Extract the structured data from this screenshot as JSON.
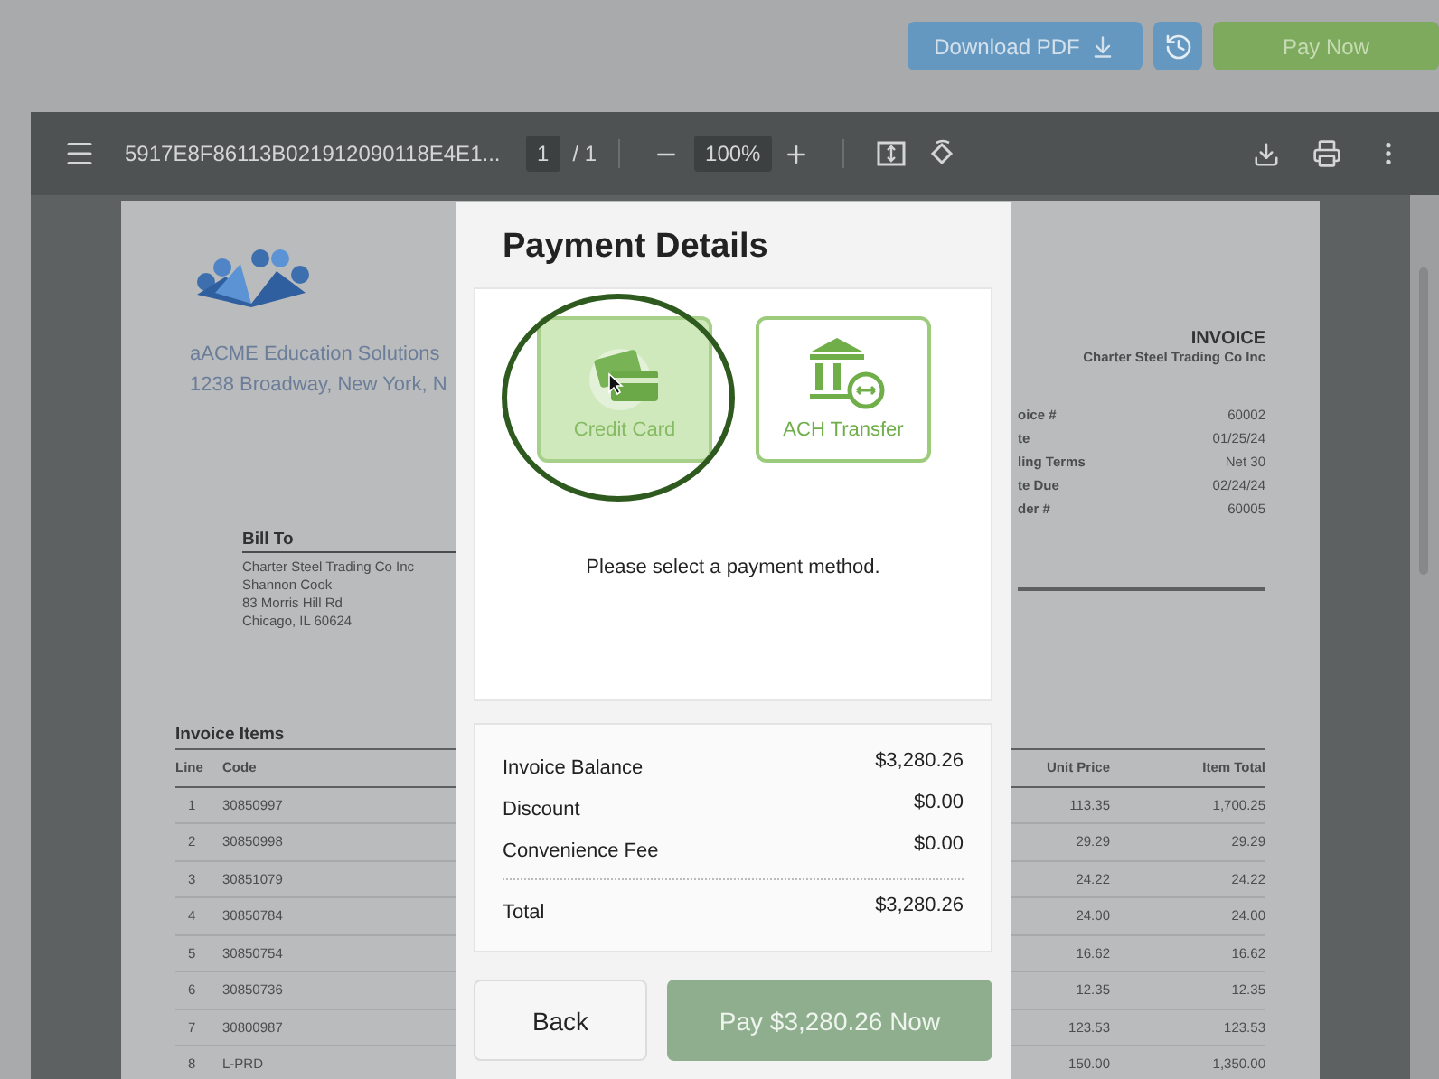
{
  "header_actions": {
    "download_button": "Download PDF",
    "pay_button": "Pay Now"
  },
  "viewer": {
    "filename": "5917E8F86113B021912090118E4E1...",
    "page_current": "1",
    "page_total": "/ 1",
    "zoom": "100%"
  },
  "invoice": {
    "company_name": "aACME Education Solutions",
    "company_address": "1238 Broadway, New York, N",
    "bill_to": {
      "heading": "Bill To",
      "lines": [
        "Charter Steel Trading Co Inc",
        "Shannon Cook",
        "83 Morris Hill Rd",
        "Chicago, IL 60624"
      ]
    },
    "title": "INVOICE",
    "customer": "Charter Steel Trading Co Inc",
    "meta": [
      {
        "label": "oice #",
        "value": "60002"
      },
      {
        "label": "te",
        "value": "01/25/24"
      },
      {
        "label": "ling Terms",
        "value": "Net 30"
      },
      {
        "label": "te Due",
        "value": "02/24/24"
      },
      {
        "label": "der #",
        "value": "60005"
      }
    ],
    "items": {
      "heading": "Invoice Items",
      "columns": {
        "line": "Line",
        "code": "Code",
        "unit_price": "Unit Price",
        "item_total": "Item Total"
      },
      "rows": [
        {
          "line": "1",
          "code": "30850997",
          "unit_price": "113.35",
          "item_total": "1,700.25"
        },
        {
          "line": "2",
          "code": "30850998",
          "unit_price": "29.29",
          "item_total": "29.29"
        },
        {
          "line": "3",
          "code": "30851079",
          "unit_price": "24.22",
          "item_total": "24.22"
        },
        {
          "line": "4",
          "code": "30850784",
          "unit_price": "24.00",
          "item_total": "24.00"
        },
        {
          "line": "5",
          "code": "30850754",
          "unit_price": "16.62",
          "item_total": "16.62"
        },
        {
          "line": "6",
          "code": "30850736",
          "unit_price": "12.35",
          "item_total": "12.35"
        },
        {
          "line": "7",
          "code": "30800987",
          "unit_price": "123.53",
          "item_total": "123.53"
        },
        {
          "line": "8",
          "code": "L-PRD",
          "unit_price": "150.00",
          "item_total": "1,350.00"
        }
      ]
    }
  },
  "payment_modal": {
    "title": "Payment Details",
    "methods": [
      {
        "label": "Credit Card",
        "kind": "card",
        "selected": true
      },
      {
        "label": "ACH Transfer",
        "kind": "bank",
        "selected": false
      }
    ],
    "prompt": "Please select a payment method.",
    "summary": [
      {
        "label": "Invoice Balance",
        "value": "$3,280.26"
      },
      {
        "label": "Discount",
        "value": "$0.00"
      },
      {
        "label": "Convenience Fee",
        "value": "$0.00"
      }
    ],
    "total": {
      "label": "Total",
      "value": "$3,280.26"
    },
    "back_button": "Back",
    "pay_button": {
      "label": "Pay $3,280.26 Now",
      "disabled": true
    }
  }
}
